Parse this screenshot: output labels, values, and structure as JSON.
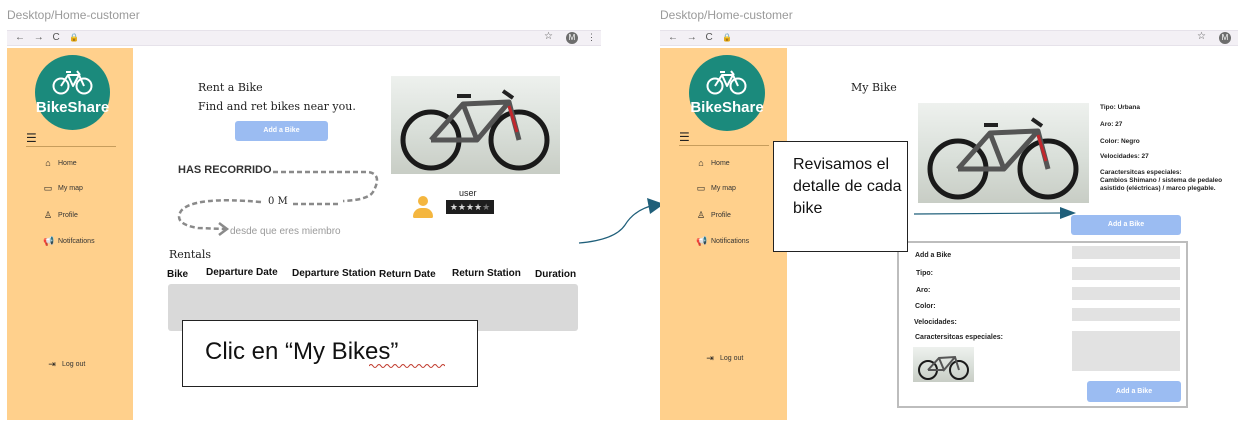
{
  "left_screen": {
    "title": "Desktop/Home-customer",
    "browser": {
      "nav": "← → C",
      "avatar": "M"
    },
    "sidebar": {
      "logo_text": "BikeShare",
      "items": [
        {
          "label": "Home",
          "icon": "home-icon"
        },
        {
          "label": "My map",
          "icon": "folder-icon"
        },
        {
          "label": "Profile",
          "icon": "user-icon"
        },
        {
          "label": "Notifcations",
          "icon": "megaphone-icon"
        }
      ],
      "logout": "Log out"
    },
    "main": {
      "rent_title": "Rent a Bike",
      "rent_subtitle": "Find and ret bikes near you.",
      "add_button": "Add a Bike",
      "has_recorrido": "HAS RECORRIDO",
      "distance": "0 M",
      "since_member": "desde que eres miembro",
      "user_label": "user",
      "rating_stars": 4,
      "rentals_title": "Rentals",
      "table_headers": [
        "Bike",
        "Departure Date",
        "Departure Station",
        "Return Date",
        "Return Station",
        "Duration"
      ]
    },
    "callout": "Clic en “My Bikes”"
  },
  "right_screen": {
    "title": "Desktop/Home-customer",
    "browser": {
      "avatar": "M"
    },
    "sidebar": {
      "logo_text": "BikeShare",
      "items": [
        {
          "label": "Home",
          "icon": "home-icon"
        },
        {
          "label": "My map",
          "icon": "folder-icon"
        },
        {
          "label": "Profile",
          "icon": "user-icon"
        },
        {
          "label": "Notifications",
          "icon": "megaphone-icon"
        }
      ],
      "logout": "Log out"
    },
    "main": {
      "title": "My Bike",
      "details": [
        "Tipo: Urbana",
        "Aro: 27",
        "Color: Negro",
        "Velocidades: 27",
        "Caractersitcas especiales:",
        "Cambios Shimano / sistema de pedaleo asistido (eléctricas) / marco plegable."
      ],
      "add_button": "Add a Bike",
      "form": {
        "title": "Add a Bike",
        "labels": [
          "Tipo:",
          "Aro:",
          "Color:",
          "Velocidades:",
          "Caractersitcas especiales:"
        ],
        "submit": "Add a Bike"
      }
    },
    "callout": "Revisamos el detalle de cada bike"
  },
  "colors": {
    "sidebar": "#ffd08c",
    "logo": "#1b8a7c",
    "button": "#9bbcf2",
    "arrow": "#1f5f7a"
  }
}
